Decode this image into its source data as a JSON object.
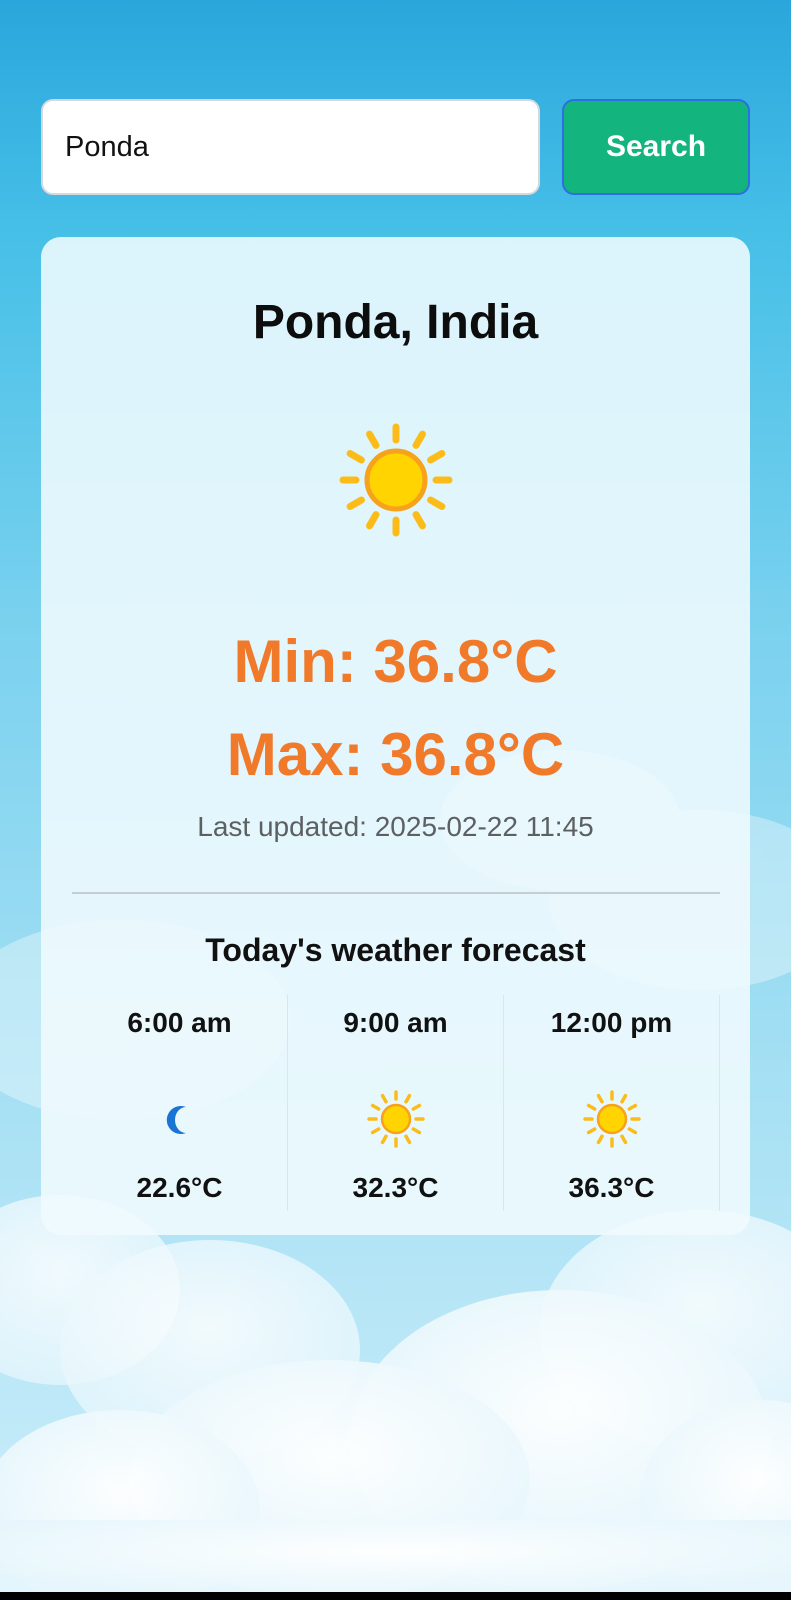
{
  "search": {
    "value": "Ponda",
    "button_label": "Search"
  },
  "weather": {
    "location": "Ponda, India",
    "condition_icon": "sun-icon",
    "min_temp": "Min: 36.8°C",
    "max_temp": "Max: 36.8°C",
    "last_updated": "Last updated: 2025-02-22 11:45"
  },
  "forecast": {
    "title": "Today's weather forecast",
    "items": [
      {
        "time": "6:00 am",
        "icon": "moon-icon",
        "temp": "22.6°C"
      },
      {
        "time": "9:00 am",
        "icon": "sun-icon",
        "temp": "32.3°C"
      },
      {
        "time": "12:00 pm",
        "icon": "sun-icon",
        "temp": "36.3°C"
      }
    ]
  },
  "colors": {
    "accent_button": "#14b47e",
    "temperature": "#f07a2a",
    "sky_top": "#2aa6dc",
    "sky_bottom": "#cdeefa"
  }
}
